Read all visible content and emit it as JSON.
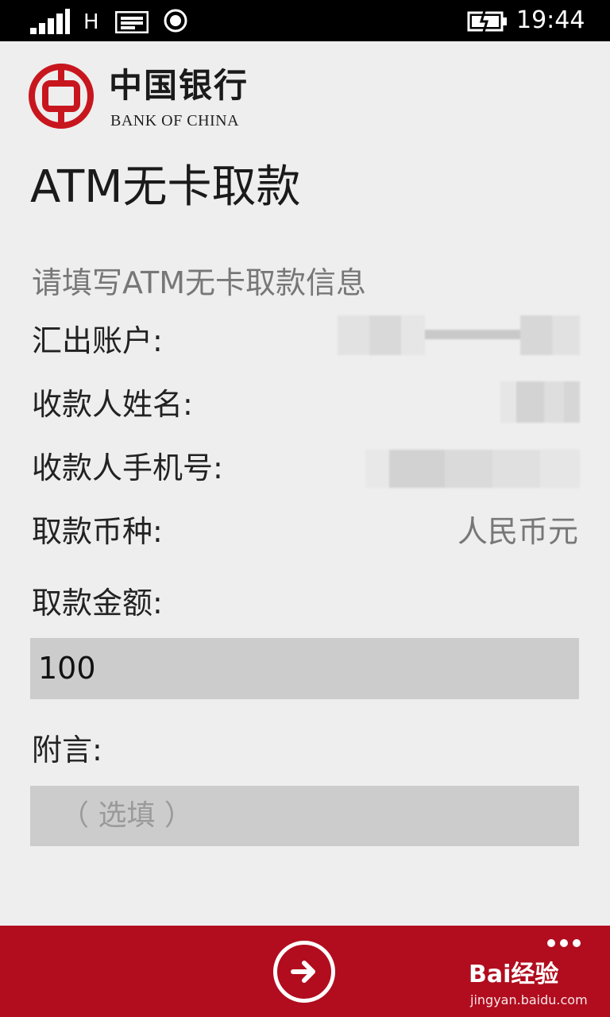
{
  "status_bar": {
    "network_type": "H",
    "time": "19:44"
  },
  "brand": {
    "name_cn": "中国银行",
    "name_en": "BANK OF CHINA",
    "color": "#c8161e"
  },
  "page": {
    "title": "ATM无卡取款",
    "subtitle": "请填写ATM无卡取款信息"
  },
  "form": {
    "source_account_label": "汇出账户:",
    "payee_name_label": "收款人姓名:",
    "payee_phone_label": "收款人手机号:",
    "currency_label": "取款币种:",
    "currency_value": "人民币元",
    "amount_label": "取款金额:",
    "amount_value": "100",
    "note_label": "附言:",
    "note_placeholder": "（ 选填 ）"
  },
  "app_bar": {
    "color": "#b10d1e",
    "next_icon": "arrow-right-circle-icon",
    "more_icon": "more-dots-icon"
  },
  "watermark": {
    "line1": "Bai经验",
    "line2": "jingyan.baidu.com"
  }
}
